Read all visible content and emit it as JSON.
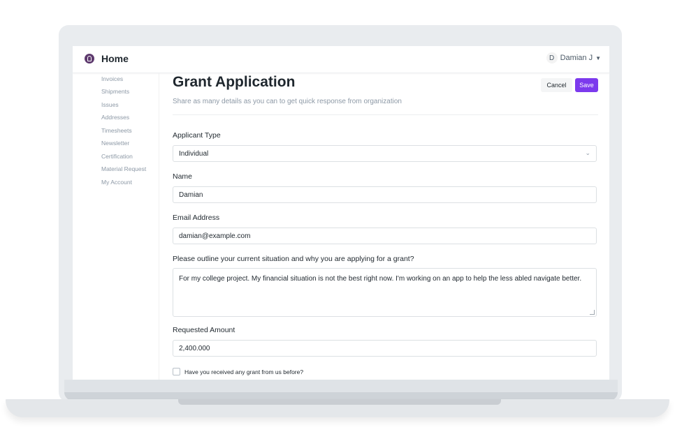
{
  "header": {
    "title": "Home",
    "user_initial": "D",
    "user_name": "Damian J"
  },
  "sidebar": {
    "items": [
      {
        "label": "Invoices"
      },
      {
        "label": "Shipments"
      },
      {
        "label": "Issues"
      },
      {
        "label": "Addresses"
      },
      {
        "label": "Timesheets"
      },
      {
        "label": "Newsletter"
      },
      {
        "label": "Certification"
      },
      {
        "label": "Material Request"
      },
      {
        "label": "My Account"
      }
    ]
  },
  "page": {
    "title": "Grant Application",
    "subtitle": "Share as many details as you can to get quick response from organization",
    "cancel_label": "Cancel",
    "save_label": "Save"
  },
  "form": {
    "applicant_type": {
      "label": "Applicant Type",
      "value": "Individual"
    },
    "name": {
      "label": "Name",
      "value": "Damian"
    },
    "email": {
      "label": "Email Address",
      "value": "damian@example.com"
    },
    "situation": {
      "label": "Please outline your current situation and why you are applying for a grant?",
      "value": "For my college project. My financial situation is not the best right now. I'm working on an app to help the less abled navigate better."
    },
    "amount": {
      "label": "Requested Amount",
      "value": "2,400.000"
    },
    "received_before": {
      "label": "Have you received any grant from us before?",
      "checked": false
    }
  },
  "colors": {
    "accent": "#7c3aed",
    "logo": "#5e3a6e"
  }
}
